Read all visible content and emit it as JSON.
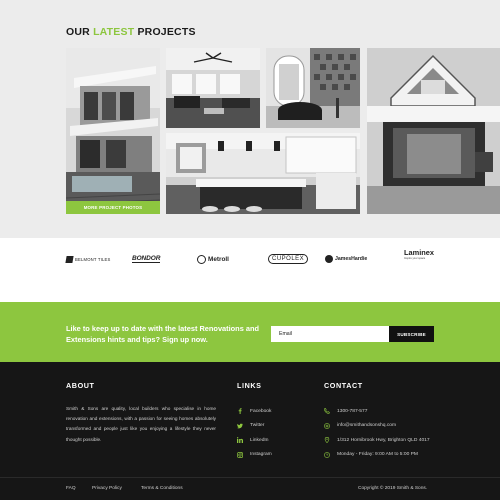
{
  "projects": {
    "title_prefix": "OUR",
    "title_accent": "LATEST",
    "title_suffix": "PROJECTS",
    "more_button": "MORE PROJECT PHOTOS"
  },
  "brands": [
    "BELMONT TILES",
    "BONDOR",
    "Metroll",
    "CUPOLEX",
    "JamesHardie",
    "Laminex",
    "Inspire your space"
  ],
  "newsletter": {
    "text": "Like to keep up to date with the latest Renovations and Extensions hints and tips? Sign up now.",
    "email_placeholder": "Email",
    "subscribe_label": "SUBSCRIBE"
  },
  "footer": {
    "about_title": "ABOUT",
    "about_text": "Smith & Sons are quality, local builders who specialise in home renovation and extensions, with a passion for seeing homes absolutely transformed and people just like you enjoying a lifestyle they never thought possible.",
    "links_title": "LINKS",
    "links": [
      {
        "label": "Facebook",
        "icon": "facebook-icon"
      },
      {
        "label": "Twitter",
        "icon": "twitter-icon"
      },
      {
        "label": "LinkedIn",
        "icon": "linkedin-icon"
      },
      {
        "label": "Instagram",
        "icon": "instagram-icon"
      }
    ],
    "contact_title": "CONTACT",
    "contact": [
      {
        "label": "1300-787-577",
        "icon": "phone-icon"
      },
      {
        "label": "info@smithandsonshq.com",
        "icon": "email-icon"
      },
      {
        "label": "1/312 Hornibrook Hwy, Brighton QLD 4017",
        "icon": "location-icon"
      },
      {
        "label": "Monday - Friday: 9:00 AM to 5:00 PM",
        "icon": "clock-icon"
      }
    ],
    "bottom_links": [
      "FAQ",
      "Privacy Policy",
      "Terms & Conditions"
    ],
    "copyright": "Copyright © 2019 Smith & Sons."
  },
  "colors": {
    "accent": "#8dc63f",
    "dark": "#161616",
    "projects_bg": "#ececec"
  }
}
